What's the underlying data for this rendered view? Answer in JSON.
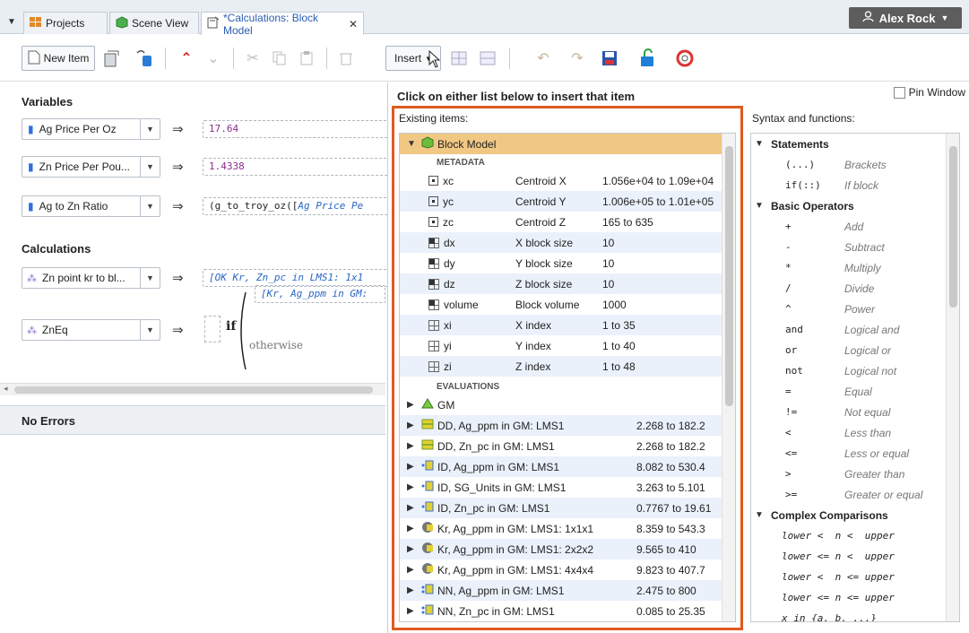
{
  "tabs": {
    "projects": "Projects",
    "scene_view": "Scene View",
    "calculations": "*Calculations: Block Model"
  },
  "user": {
    "name": "Alex Rock"
  },
  "toolbar": {
    "new_item": "New Item",
    "insert": "Insert"
  },
  "left": {
    "variables_title": "Variables",
    "variables": [
      {
        "label": "Ag Price Per Oz",
        "expr": "17.64"
      },
      {
        "label": "Zn Price Per Pou...",
        "expr": "1.4338"
      },
      {
        "label": "Ag to Zn Ratio",
        "expr_a": "(g_to_troy_oz([",
        "expr_b": "Ag Price Pe"
      }
    ],
    "calculations_title": "Calculations",
    "calculations": [
      {
        "label": "Zn point kr to bl...",
        "expr": "[OK Kr, Zn_pc in LMS1: 1x1"
      },
      {
        "label": "ZnEq",
        "if_kw": "if",
        "line1": "[Kr, Ag_ppm in GM:",
        "otherwise": "otherwise"
      }
    ],
    "errors_title": "No Errors"
  },
  "popup": {
    "title": "Click on either list below to insert that item",
    "pin_window": "Pin Window",
    "existing_label": "Existing items:",
    "syntax_label": "Syntax and functions:"
  },
  "existing": {
    "root": "Block Model",
    "metadata_label": "METADATA",
    "metadata": [
      {
        "name": "xc",
        "desc": "Centroid X",
        "value": "1.056e+04 to 1.09e+04"
      },
      {
        "name": "yc",
        "desc": "Centroid Y",
        "value": "1.006e+05 to 1.01e+05"
      },
      {
        "name": "zc",
        "desc": "Centroid Z",
        "value": "165 to 635"
      },
      {
        "name": "dx",
        "desc": "X block size",
        "value": "10"
      },
      {
        "name": "dy",
        "desc": "Y block size",
        "value": "10"
      },
      {
        "name": "dz",
        "desc": "Z block size",
        "value": "10"
      },
      {
        "name": "volume",
        "desc": "Block volume",
        "value": "1000"
      },
      {
        "name": "xi",
        "desc": "X index",
        "value": "1 to 35"
      },
      {
        "name": "yi",
        "desc": "Y index",
        "value": "1 to 40"
      },
      {
        "name": "zi",
        "desc": "Z index",
        "value": "1 to 48"
      }
    ],
    "evaluations_label": "EVALUATIONS",
    "evaluations": [
      {
        "name": "GM",
        "value": ""
      },
      {
        "name": "DD, Ag_ppm in GM: LMS1",
        "value": "2.268 to 182.2"
      },
      {
        "name": "DD, Zn_pc in GM: LMS1",
        "value": "2.268 to 182.2"
      },
      {
        "name": "ID, Ag_ppm in GM: LMS1",
        "value": "8.082 to 530.4"
      },
      {
        "name": "ID, SG_Units in GM: LMS1",
        "value": "3.263 to 5.101"
      },
      {
        "name": "ID, Zn_pc in GM: LMS1",
        "value": "0.7767 to 19.61"
      },
      {
        "name": "Kr, Ag_ppm in GM: LMS1: 1x1x1",
        "value": "8.359 to 543.3"
      },
      {
        "name": "Kr, Ag_ppm in GM: LMS1: 2x2x2",
        "value": "9.565 to 410"
      },
      {
        "name": "Kr, Ag_ppm in GM: LMS1: 4x4x4",
        "value": "9.823 to 407.7"
      },
      {
        "name": "NN, Ag_ppm in GM: LMS1",
        "value": "2.475 to 800"
      },
      {
        "name": "NN, Zn_pc in GM: LMS1",
        "value": "0.085 to 25.35"
      }
    ]
  },
  "syntax": {
    "statements_label": "Statements",
    "statements": [
      {
        "sym": "(...)",
        "desc": "Brackets"
      },
      {
        "sym": "if(::)",
        "desc": "If block"
      }
    ],
    "basic_label": "Basic Operators",
    "basic": [
      {
        "sym": "+",
        "desc": "Add"
      },
      {
        "sym": "-",
        "desc": "Subtract"
      },
      {
        "sym": "*",
        "desc": "Multiply"
      },
      {
        "sym": "/",
        "desc": "Divide"
      },
      {
        "sym": "^",
        "desc": "Power"
      },
      {
        "sym": "and",
        "desc": "Logical and"
      },
      {
        "sym": "or",
        "desc": "Logical or"
      },
      {
        "sym": "not",
        "desc": "Logical not"
      },
      {
        "sym": "=",
        "desc": "Equal"
      },
      {
        "sym": "!=",
        "desc": "Not equal"
      },
      {
        "sym": "<",
        "desc": "Less than"
      },
      {
        "sym": "<=",
        "desc": "Less or equal"
      },
      {
        "sym": ">",
        "desc": "Greater than"
      },
      {
        "sym": ">=",
        "desc": "Greater or equal"
      }
    ],
    "complex_label": "Complex Comparisons",
    "complex": [
      "lower <  n <  upper",
      "lower <= n <  upper",
      "lower <  n <= upper",
      "lower <= n <= upper",
      "x in {a, b, ...}"
    ]
  },
  "colors": {
    "highlight_frame": "#e05a20",
    "root_row": "#f1c784",
    "alt_row": "#eaf1fb",
    "user_button": "#5d5d5d"
  }
}
